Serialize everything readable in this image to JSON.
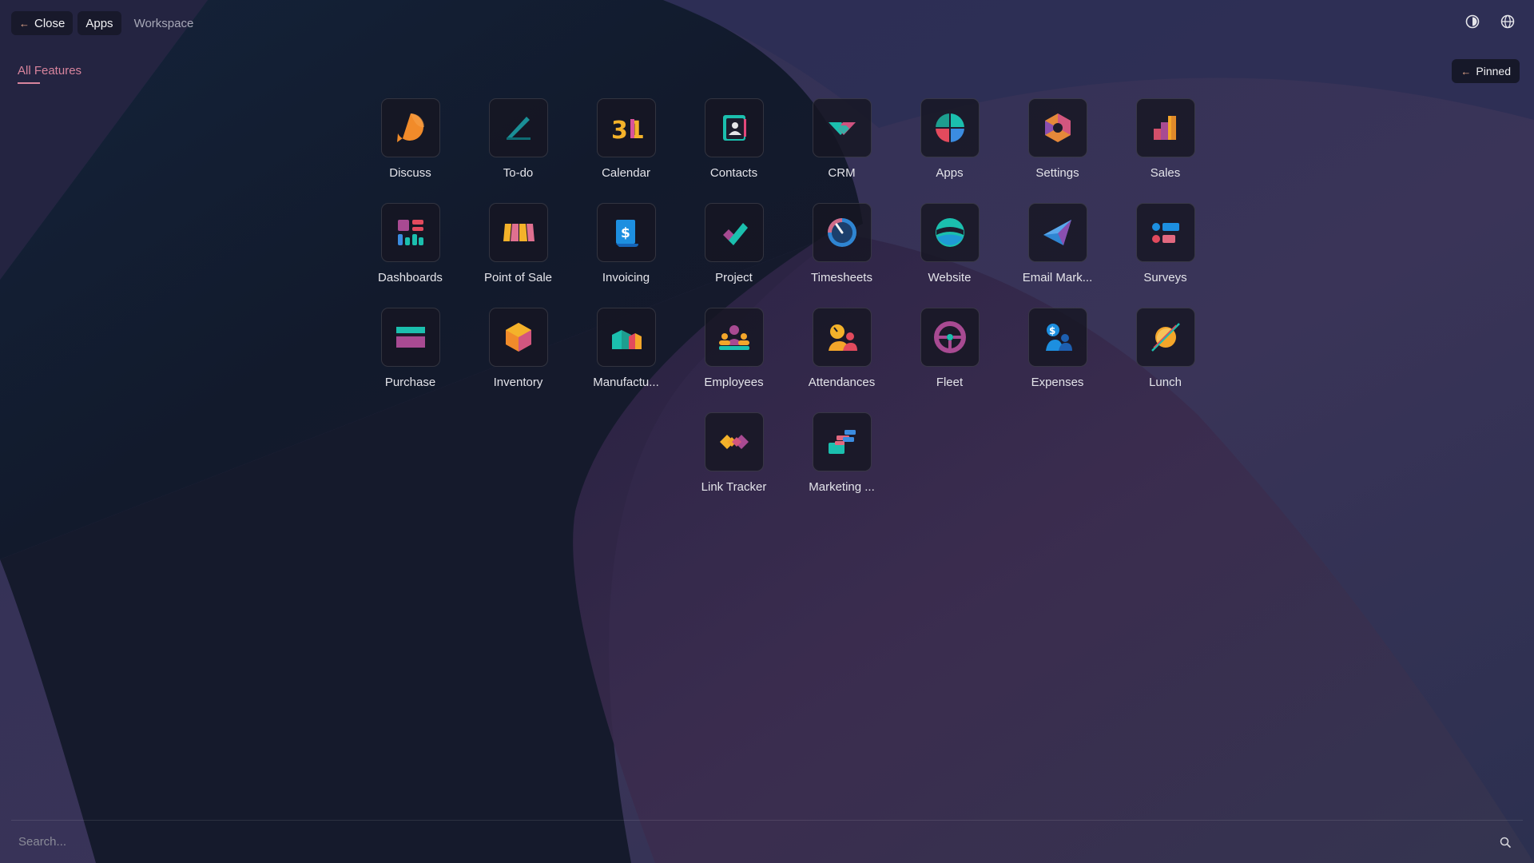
{
  "topbar": {
    "close_label": "Close",
    "apps_label": "Apps",
    "workspace_label": "Workspace"
  },
  "filter": {
    "all_features_label": "All Features"
  },
  "pinned_label": "Pinned",
  "colors": {
    "accent": "#d8849d",
    "tile_bg": "#16161f",
    "background": "#1c1d33"
  },
  "apps": [
    {
      "label": "Discuss",
      "icon": "discuss-icon"
    },
    {
      "label": "To-do",
      "icon": "todo-icon"
    },
    {
      "label": "Calendar",
      "icon": "calendar-icon",
      "icon_text": "31"
    },
    {
      "label": "Contacts",
      "icon": "contacts-icon"
    },
    {
      "label": "CRM",
      "icon": "crm-icon"
    },
    {
      "label": "Apps",
      "icon": "apps-icon"
    },
    {
      "label": "Settings",
      "icon": "settings-icon"
    },
    {
      "label": "Sales",
      "icon": "sales-icon"
    },
    {
      "label": "Dashboards",
      "icon": "dashboards-icon"
    },
    {
      "label": "Point of Sale",
      "icon": "point-of-sale-icon"
    },
    {
      "label": "Invoicing",
      "icon": "invoicing-icon",
      "icon_text": "$"
    },
    {
      "label": "Project",
      "icon": "project-icon"
    },
    {
      "label": "Timesheets",
      "icon": "timesheets-icon"
    },
    {
      "label": "Website",
      "icon": "website-icon"
    },
    {
      "label": "Email Mark...",
      "icon": "email-marketing-icon"
    },
    {
      "label": "Surveys",
      "icon": "surveys-icon"
    },
    {
      "label": "Purchase",
      "icon": "purchase-icon"
    },
    {
      "label": "Inventory",
      "icon": "inventory-icon"
    },
    {
      "label": "Manufactu...",
      "icon": "manufacturing-icon"
    },
    {
      "label": "Employees",
      "icon": "employees-icon"
    },
    {
      "label": "Attendances",
      "icon": "attendances-icon"
    },
    {
      "label": "Fleet",
      "icon": "fleet-icon"
    },
    {
      "label": "Expenses",
      "icon": "expenses-icon",
      "icon_text": "$"
    },
    {
      "label": "Lunch",
      "icon": "lunch-icon"
    },
    {
      "label": "Link Tracker",
      "icon": "link-tracker-icon"
    },
    {
      "label": "Marketing ...",
      "icon": "marketing-automation-icon"
    }
  ],
  "search": {
    "placeholder": "Search..."
  }
}
